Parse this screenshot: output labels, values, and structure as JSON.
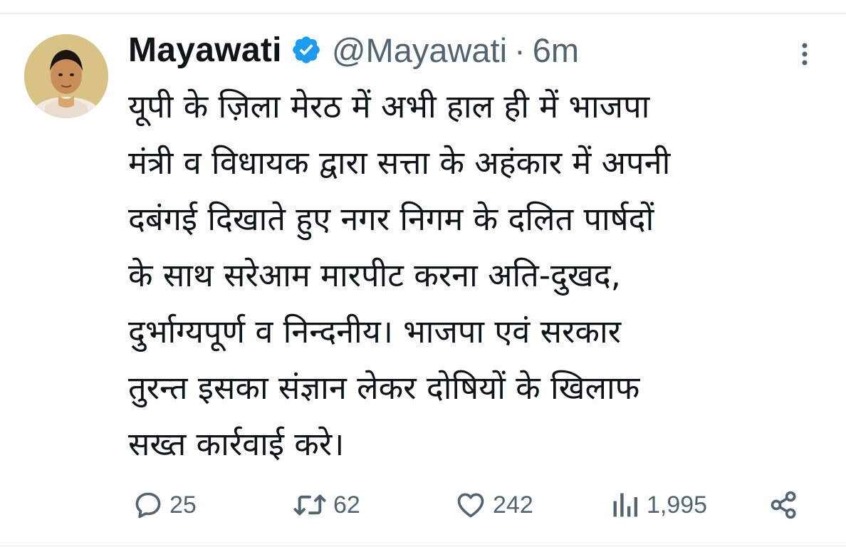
{
  "tweet": {
    "display_name": "Mayawati",
    "handle": "@Mayawati",
    "separator": "·",
    "time": "6m",
    "text_lines": [
      "यूपी के ज़िला मेरठ में अभी हाल ही में भाजपा",
      "मंत्री व विधायक द्वारा सत्ता के अहंकार में अपनी",
      "दबंगई दिखाते हुए नगर निगम के दलित पार्षदों",
      "के साथ सरेआम मारपीट करना अति-दुखद,",
      "दुर्भाग्यपूर्ण व निन्दनीय। भाजपा एवं सरकार",
      "तुरन्त इसका संज्ञान लेकर दोषियों के खिलाफ",
      "सख्त कार्रवाई करे।"
    ]
  },
  "actions": {
    "replies": "25",
    "retweets": "62",
    "likes": "242",
    "views": "1,995"
  },
  "icons": {
    "verified": "verified-badge-icon",
    "more": "more-options-icon",
    "reply": "reply-icon",
    "retweet": "retweet-icon",
    "like": "heart-icon",
    "views": "views-bar-chart-icon",
    "share": "share-icon"
  },
  "colors": {
    "verified_blue": "#1d9bf0",
    "text_primary": "#0f1419",
    "text_secondary": "#536471"
  }
}
